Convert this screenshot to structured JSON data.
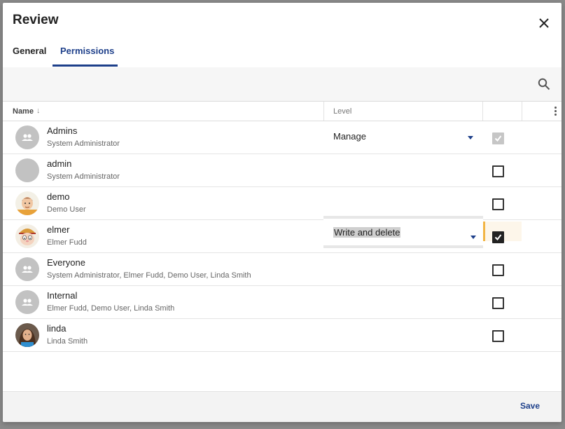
{
  "dialog": {
    "title": "Review",
    "close_icon": "close-icon",
    "save_label": "Save"
  },
  "tabs": [
    {
      "label": "General",
      "active": false
    },
    {
      "label": "Permissions",
      "active": true
    }
  ],
  "toolbar": {
    "search_icon": "search-icon"
  },
  "table": {
    "columns": {
      "name": "Name",
      "level": "Level"
    },
    "sort": "name-ascending",
    "rows": [
      {
        "name": "Admins",
        "subtitle": "System Administrator",
        "avatar": "group-icon",
        "level": "Manage",
        "checked": true,
        "disabled": true
      },
      {
        "name": "admin",
        "subtitle": "System Administrator",
        "avatar": "blank-avatar",
        "level": "",
        "checked": false,
        "disabled": false
      },
      {
        "name": "demo",
        "subtitle": "Demo User",
        "avatar": "demo-avatar",
        "level": "",
        "checked": false,
        "disabled": false
      },
      {
        "name": "elmer",
        "subtitle": "Elmer Fudd",
        "avatar": "elmer-avatar",
        "level": "Write and delete",
        "checked": true,
        "disabled": false,
        "focused": true
      },
      {
        "name": "Everyone",
        "subtitle": "System Administrator, Elmer Fudd, Demo User, Linda Smith",
        "avatar": "group-icon",
        "level": "",
        "checked": false,
        "disabled": false
      },
      {
        "name": "Internal",
        "subtitle": "Elmer Fudd, Demo User, Linda Smith",
        "avatar": "group-icon",
        "level": "",
        "checked": false,
        "disabled": false
      },
      {
        "name": "linda",
        "subtitle": "Linda Smith",
        "avatar": "linda-avatar",
        "level": "",
        "checked": false,
        "disabled": false
      }
    ]
  },
  "colors": {
    "accent": "#1d3f8a",
    "focus": "#f2b544",
    "toolbar_bg": "#f6f6f6"
  }
}
